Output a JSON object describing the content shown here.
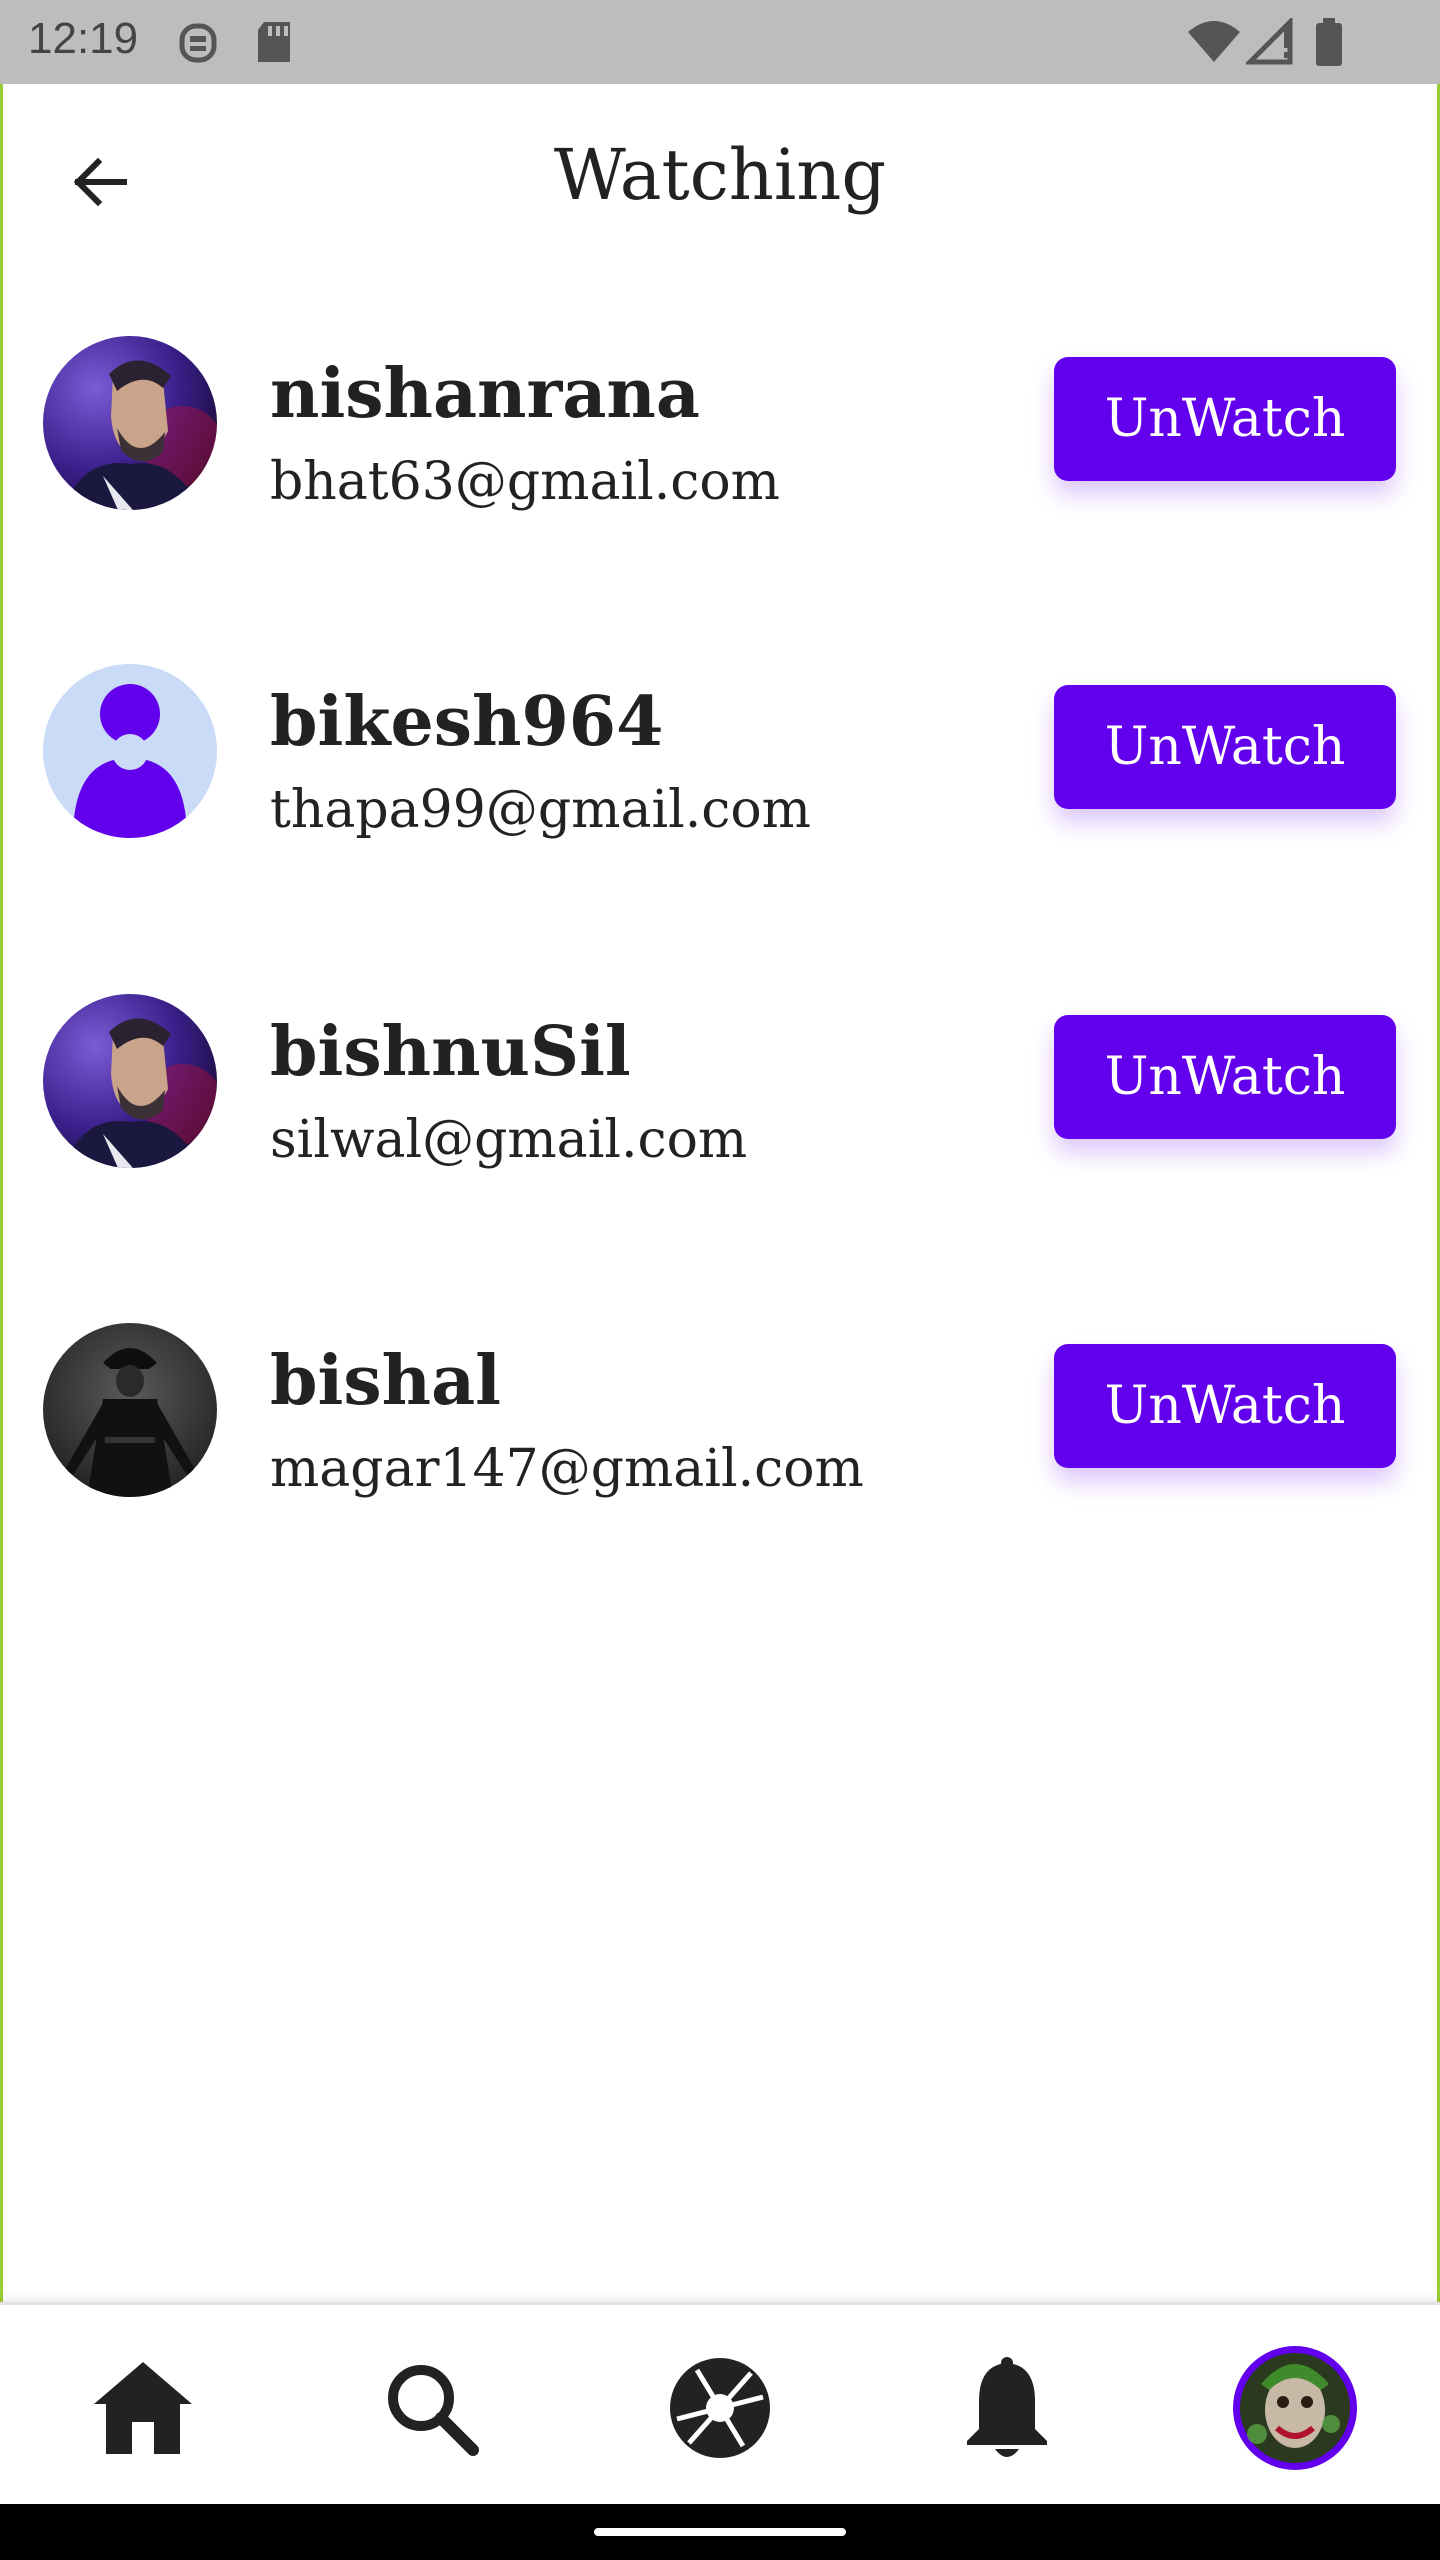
{
  "status_bar": {
    "time": "12:19",
    "icons": [
      "ghost-app-icon",
      "sd-card-icon",
      "wifi-icon",
      "signal-icon",
      "battery-icon"
    ]
  },
  "app_bar": {
    "title": "Watching",
    "back_icon": "arrow-back-icon"
  },
  "users": [
    {
      "name": "nishanrana",
      "email": "bhat63@gmail.com",
      "avatar": "wolverine-avatar",
      "button": "UnWatch"
    },
    {
      "name": "bikesh964",
      "email": "thapa99@gmail.com",
      "avatar": "default-person-avatar",
      "button": "UnWatch"
    },
    {
      "name": "bishnuSil",
      "email": "silwal@gmail.com",
      "avatar": "wolverine-avatar",
      "button": "UnWatch"
    },
    {
      "name": "bishal",
      "email": "magar147@gmail.com",
      "avatar": "v-vendetta-avatar",
      "button": "UnWatch"
    }
  ],
  "bottom_nav": {
    "items": [
      "home-icon",
      "search-icon",
      "camera-shutter-icon",
      "notifications-bell-icon",
      "profile-avatar"
    ]
  },
  "colors": {
    "accent": "#6200ee",
    "status_bar": "#bdbdbd",
    "frame": "#9acd32"
  }
}
